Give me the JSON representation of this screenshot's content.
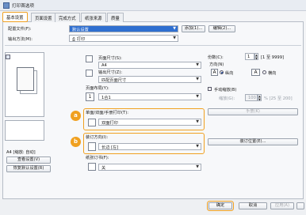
{
  "window": {
    "title": "打印首选项"
  },
  "tabs": [
    {
      "label": "基本设置",
      "active": true
    },
    {
      "label": "页面设置"
    },
    {
      "label": "完成方式"
    },
    {
      "label": "纸张来源"
    },
    {
      "label": "质量"
    }
  ],
  "profile": {
    "label": "配置文件(F):",
    "value": "默认设置",
    "add_label": "添加(1)...",
    "edit_label": "编辑(2)..."
  },
  "output": {
    "label": "输出方法(M):",
    "value": "打印"
  },
  "preview": {
    "status": "A4 [缩放: 自动]",
    "view_settings_label": "查看设置(V)",
    "restore_defaults_label": "恢复默认设置(R)"
  },
  "page": {
    "page_size_label": "页面尺寸(S):",
    "page_size_value": "A4",
    "output_size_label": "输出尺寸(Z):",
    "output_size_value": "匹配页面尺寸",
    "layout_label": "页面布局(Y):",
    "layout_value": "1合1"
  },
  "copies": {
    "label": "份数(C):",
    "value": "1",
    "range": "[1 至 9999]"
  },
  "orientation": {
    "label": "方向(N)",
    "portrait_label": "纵向",
    "landscape_label": "横向"
  },
  "manual_scaling": {
    "label": "手动缩放(B)",
    "value_label": "缩放(G):",
    "value": "100",
    "range": "% [25 至 200]"
  },
  "duplex": {
    "badge": "a",
    "label": "单面/双面/手册打印(T):",
    "value": "双面打印",
    "settings_label": "手册(K)"
  },
  "binding": {
    "badge": "b",
    "label": "装订方向(I):",
    "value": "长边 [左]",
    "settings_label": "装订位置(E)..."
  },
  "staple": {
    "label": "纸张订书(F):",
    "value": "关"
  },
  "footer": {
    "ok_label": "确定",
    "cancel_label": "取消",
    "apply_label": "应用(A)",
    "help_label": "帮助"
  }
}
